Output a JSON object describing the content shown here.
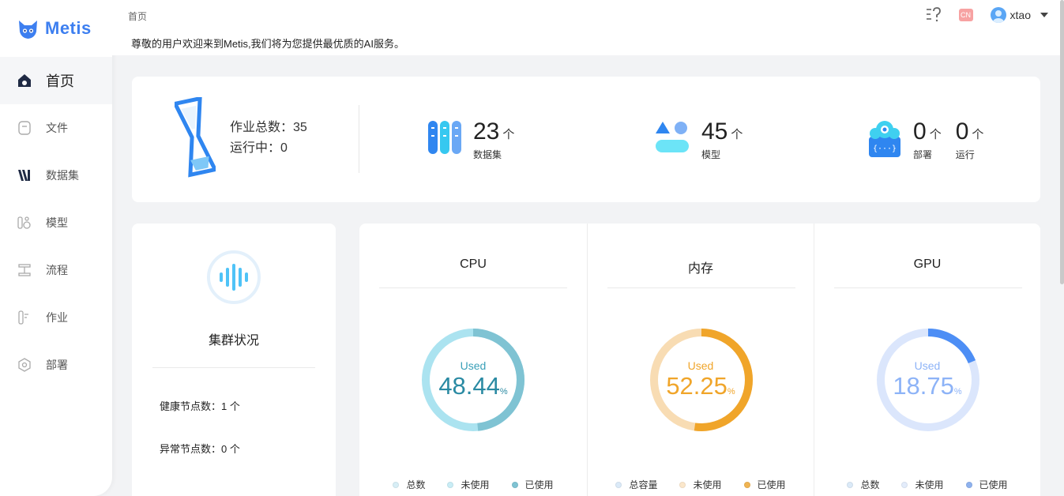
{
  "app": {
    "name": "Metis"
  },
  "sidebar": {
    "items": [
      {
        "label": "首页",
        "icon": "home-icon",
        "active": true
      },
      {
        "label": "文件",
        "icon": "file-icon"
      },
      {
        "label": "数据集",
        "icon": "dataset-icon"
      },
      {
        "label": "模型",
        "icon": "model-icon"
      },
      {
        "label": "流程",
        "icon": "workflow-icon"
      },
      {
        "label": "作业",
        "icon": "job-icon"
      },
      {
        "label": "部署",
        "icon": "deploy-icon"
      }
    ]
  },
  "header": {
    "breadcrumb": "首页",
    "welcome": "尊敬的用户欢迎来到Metis,我们将为您提供最优质的AI服务。",
    "lang": "CN",
    "user": "xtao"
  },
  "stats": {
    "jobs_total_label": "作业总数：35",
    "jobs_running_label": "运行中：0",
    "datasets": {
      "value": "23",
      "unit": "个",
      "label": "数据集"
    },
    "models": {
      "value": "45",
      "unit": "个",
      "label": "模型"
    },
    "deploy": {
      "value": "0",
      "unit": "个",
      "label": "部署"
    },
    "running": {
      "value": "0",
      "unit": "个",
      "label": "运行"
    }
  },
  "cluster": {
    "title": "集群状况",
    "healthy": "健康节点数：1 个",
    "abnormal": "异常节点数：0 个"
  },
  "resources": [
    {
      "title": "CPU",
      "used_label": "Used",
      "percent": 48.44,
      "percent_text": "48.44",
      "unit": "%",
      "color": "#7fc3d3",
      "track": "#abe3f0",
      "text_color": "#2a8aa3",
      "label_color": "#3aa0b8",
      "legend": [
        {
          "label": "总数",
          "color": "#d7eef6"
        },
        {
          "label": "未使用",
          "color": "#c9edf6"
        },
        {
          "label": "已使用",
          "color": "#7fc3d3"
        }
      ]
    },
    {
      "title": "内存",
      "used_label": "Used",
      "percent": 52.25,
      "percent_text": "52.25",
      "unit": "%",
      "color": "#f0a52a",
      "track": "#f8dcb3",
      "text_color": "#f0a52a",
      "label_color": "#f0a52a",
      "legend": [
        {
          "label": "总容量",
          "color": "#dbeaf8"
        },
        {
          "label": "未使用",
          "color": "#fbe7cb"
        },
        {
          "label": "已使用",
          "color": "#f0b452"
        }
      ]
    },
    {
      "title": "GPU",
      "used_label": "Used",
      "percent": 18.75,
      "percent_text": "18.75",
      "unit": "%",
      "color": "#4d8ef5",
      "track": "#dbe6fc",
      "text_color": "#8db3f7",
      "label_color": "#8db3f7",
      "legend": [
        {
          "label": "总数",
          "color": "#dbeaf8"
        },
        {
          "label": "未使用",
          "color": "#e3ecfb"
        },
        {
          "label": "已使用",
          "color": "#8fb2ee"
        }
      ]
    }
  ]
}
